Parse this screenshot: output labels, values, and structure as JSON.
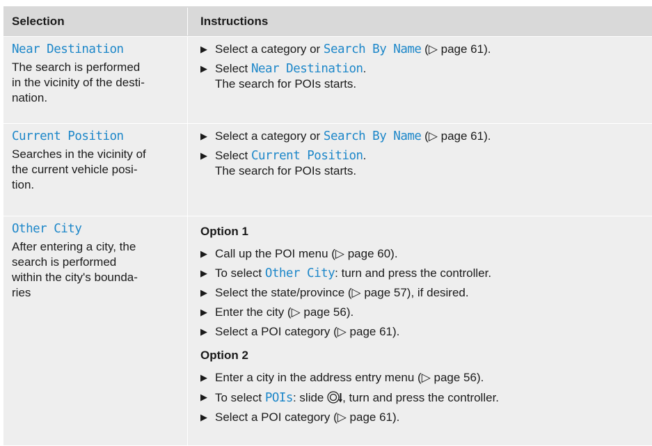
{
  "header": {
    "selection": "Selection",
    "instructions": "Instructions"
  },
  "rows": [
    {
      "option": "Near Destination",
      "description": "The search is performed in the vicinity of the desti-nation.",
      "description_lines": [
        "The search is performed",
        "in the vicinity of the desti-",
        "nation."
      ],
      "steps": [
        {
          "pre": "Select a category or ",
          "keyword": "Search By Name",
          "post": " (▷ page 61)."
        },
        {
          "pre": "Select ",
          "keyword": "Near Destination",
          "post": ".",
          "line2": "The search for POIs starts."
        }
      ]
    },
    {
      "option": "Current Position",
      "description_lines": [
        "Searches in the vicinity of",
        "the current vehicle posi-",
        "tion."
      ],
      "steps": [
        {
          "pre": "Select a category or ",
          "keyword": "Search By Name",
          "post": " (▷ page 61)."
        },
        {
          "pre": "Select ",
          "keyword": "Current Position",
          "post": ".",
          "line2": "The search for POIs starts."
        }
      ]
    },
    {
      "option": "Other City",
      "description_lines": [
        "After entering a city, the",
        "search is performed",
        "within the city's bounda-",
        "ries"
      ],
      "option1_title": "Option 1",
      "option1_steps": [
        {
          "pre": "Call up the POI menu (▷ page 60).",
          "keyword": "",
          "post": ""
        },
        {
          "pre": "To select ",
          "keyword": "Other City",
          "post": ": turn and press the controller."
        },
        {
          "pre": "Select the state/province (▷ page 57), if desired.",
          "keyword": "",
          "post": ""
        },
        {
          "pre": "Enter the city (▷ page 56).",
          "keyword": "",
          "post": ""
        },
        {
          "pre": "Select a POI category (▷ page 61).",
          "keyword": "",
          "post": ""
        }
      ],
      "option2_title": "Option 2",
      "option2_steps": [
        {
          "pre": "Enter a city in the address entry menu (▷ page 56).",
          "keyword": "",
          "post": ""
        },
        {
          "pre": "To select ",
          "keyword": "POIs",
          "post": ": slide ",
          "post2": ", turn and press the controller."
        },
        {
          "pre": "Select a POI category (▷ page 61).",
          "keyword": "",
          "post": ""
        }
      ]
    }
  ],
  "bullet_glyph": "▶",
  "colors": {
    "keyword": "#1d87c9",
    "header_bg": "#d9d9d9",
    "row_bg": "#eeeeee"
  },
  "icons": {
    "controller": "controller-slide-down-icon"
  }
}
